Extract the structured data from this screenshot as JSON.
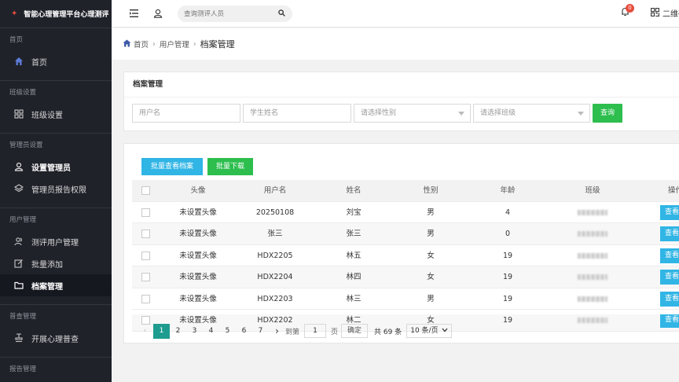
{
  "app": {
    "title": "智能心理管理平台心理测评"
  },
  "sidebar": {
    "sections": [
      {
        "title": "首页",
        "items": [
          {
            "label": "首页",
            "icon": "home-icon"
          }
        ]
      },
      {
        "title": "班级设置",
        "items": [
          {
            "label": "班级设置",
            "icon": "grid-icon"
          }
        ]
      },
      {
        "title": "管理员设置",
        "items": [
          {
            "label": "设置管理员",
            "icon": "user-icon"
          },
          {
            "label": "管理员报告权限",
            "icon": "layers-icon"
          }
        ]
      },
      {
        "title": "用户管理",
        "items": [
          {
            "label": "测评用户管理",
            "icon": "users-icon"
          },
          {
            "label": "批量添加",
            "icon": "edit-icon"
          },
          {
            "label": "档案管理",
            "icon": "folder-icon"
          }
        ]
      },
      {
        "title": "普查管理",
        "items": [
          {
            "label": "开展心理普查",
            "icon": "stamp-icon"
          }
        ]
      },
      {
        "title": "报告管理",
        "items": []
      }
    ]
  },
  "header": {
    "search_placeholder": "查询测评人员",
    "notification_count": "0",
    "qr_label": "二维码"
  },
  "breadcrumb": {
    "items": [
      "首页",
      "用户管理",
      "档案管理"
    ]
  },
  "filter": {
    "title": "档案管理",
    "username_placeholder": "用户名",
    "student_name_placeholder": "学生姓名",
    "gender_select": "请选择性别",
    "class_select": "请选择班级",
    "query_button": "查询"
  },
  "table": {
    "batch_view_button": "批量查看档案",
    "batch_download_button": "批量下载",
    "columns": [
      "头像",
      "用户名",
      "姓名",
      "性别",
      "年龄",
      "班级",
      "操作"
    ],
    "rows": [
      {
        "avatar": "未设置头像",
        "username": "20250108",
        "name": "刘宝",
        "gender": "男",
        "age": "4",
        "action": "查看"
      },
      {
        "avatar": "未设置头像",
        "username": "张三",
        "name": "张三",
        "gender": "男",
        "age": "0",
        "action": "查看"
      },
      {
        "avatar": "未设置头像",
        "username": "HDX2205",
        "name": "林五",
        "gender": "女",
        "age": "19",
        "action": "查看"
      },
      {
        "avatar": "未设置头像",
        "username": "HDX2204",
        "name": "林四",
        "gender": "女",
        "age": "19",
        "action": "查看"
      },
      {
        "avatar": "未设置头像",
        "username": "HDX2203",
        "name": "林三",
        "gender": "男",
        "age": "19",
        "action": "查看"
      },
      {
        "avatar": "未设置头像",
        "username": "HDX2202",
        "name": "林二",
        "gender": "女",
        "age": "19",
        "action": "查看"
      }
    ]
  },
  "pagination": {
    "pages": [
      "1",
      "2",
      "3",
      "4",
      "5",
      "6",
      "7"
    ],
    "current": "1",
    "goto_label": "到第",
    "page_input": "1",
    "page_unit": "页",
    "confirm": "确定",
    "total": "共 69 条",
    "page_size": "10 条/页"
  }
}
